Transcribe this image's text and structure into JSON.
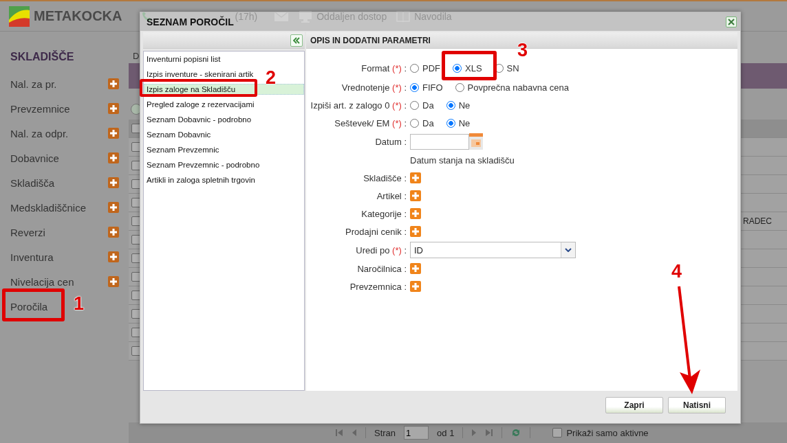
{
  "header": {
    "logo": "METAKOCKA",
    "links": [
      {
        "kind": "phone",
        "label": "(17h)"
      },
      {
        "kind": "mail"
      },
      {
        "kind": "remote",
        "label": "Oddaljen dostop"
      },
      {
        "kind": "manual",
        "label": "Navodila"
      }
    ]
  },
  "sidebar": {
    "title": "SKLADIŠČE",
    "items": [
      {
        "label": "Nal. za pr.",
        "add": true
      },
      {
        "label": "Prevzemnice",
        "add": true
      },
      {
        "label": "Nal. za odpr.",
        "add": true
      },
      {
        "label": "Dobavnice",
        "add": true
      },
      {
        "label": "Skladišča",
        "add": true
      },
      {
        "label": "Medskladiščnice",
        "add": true
      },
      {
        "label": "Reverzi",
        "add": true
      },
      {
        "label": "Inventura",
        "add": true
      },
      {
        "label": "Nivelacija cen",
        "add": true
      },
      {
        "label": "Poročila",
        "add": false
      }
    ]
  },
  "main": {
    "heading": "D",
    "table": {
      "header_checked": false,
      "rows": [
        {
          "checked": false
        },
        {
          "checked": false
        },
        {
          "checked": false
        },
        {
          "checked": false
        },
        {
          "checked": false,
          "column_3": "RADEC"
        },
        {
          "checked": false
        },
        {
          "checked": false
        },
        {
          "checked": false
        },
        {
          "checked": false
        },
        {
          "checked": false
        },
        {
          "checked": false
        },
        {
          "checked": false
        }
      ]
    },
    "pager": {
      "page_label": "Stran",
      "page": "1",
      "of": "od 1",
      "filter": {
        "label": "Prikaži samo aktivne",
        "checked": false
      }
    }
  },
  "dialog": {
    "title": "SEZNAM POROČIL",
    "reports": [
      {
        "label": "Inventurni popisni list",
        "selected": false
      },
      {
        "label": "Izpis inventure - skenirani artik",
        "selected": false
      },
      {
        "label": "Izpis zaloge na Skladišču",
        "selected": true
      },
      {
        "label": "Pregled zaloge z rezervacijami",
        "selected": false
      },
      {
        "label": "Seznam Dobavnic - podrobno",
        "selected": false
      },
      {
        "label": "Seznam Dobavnic",
        "selected": false
      },
      {
        "label": "Seznam Prevzemnic",
        "selected": false
      },
      {
        "label": "Seznam Prevzemnic - podrobno",
        "selected": false
      },
      {
        "label": "Artikli in zaloga spletnih trgovin",
        "selected": false
      }
    ],
    "params_title": "OPIS IN DODATNI PARAMETRI",
    "fields": [
      {
        "kind": "radio",
        "label": "Format",
        "mark": "(*)",
        "colon": ":",
        "options": [
          {
            "label": "PDF",
            "selected": false
          },
          {
            "label": "XLS",
            "selected": true
          },
          {
            "label": "SN",
            "selected": false
          }
        ]
      },
      {
        "kind": "radio",
        "label": "Vrednotenje",
        "mark": "(*)",
        "colon": ":",
        "options": [
          {
            "label": "FIFO",
            "selected": true
          },
          {
            "label": "Povprečna nabavna cena",
            "selected": false
          }
        ]
      },
      {
        "kind": "radio",
        "label": "Izpiši art. z zalogo 0",
        "mark": "(*)",
        "colon": ":",
        "options": [
          {
            "label": "Da",
            "selected": false
          },
          {
            "label": "Ne",
            "selected": true
          }
        ]
      },
      {
        "kind": "radio",
        "label": "Seštevek/ EM",
        "mark": "(*)",
        "colon": ":",
        "options": [
          {
            "label": "Da",
            "selected": false
          },
          {
            "label": "Ne",
            "selected": true
          }
        ]
      },
      {
        "kind": "date",
        "label": "Datum",
        "colon": ":",
        "hint": "Datum stanja na skladišču"
      },
      {
        "kind": "add",
        "label": "Skladišče",
        "colon": ":"
      },
      {
        "kind": "add",
        "label": "Artikel",
        "colon": ":"
      },
      {
        "kind": "add",
        "label": "Kategorije",
        "colon": ":"
      },
      {
        "kind": "add",
        "label": "Prodajni cenik",
        "colon": ":"
      },
      {
        "kind": "select",
        "label": "Uredi po",
        "mark": "(*)",
        "colon": ":",
        "value": "ID"
      },
      {
        "kind": "add",
        "label": "Naročilnica",
        "colon": ":"
      },
      {
        "kind": "add",
        "label": "Prevzemnica",
        "colon": ":"
      }
    ],
    "buttons": [
      {
        "label": "Zapri"
      },
      {
        "label": "Natisni"
      }
    ]
  },
  "annotations": [
    {
      "kind": "box",
      "label": "1"
    },
    {
      "kind": "box",
      "label": "2"
    },
    {
      "kind": "box",
      "label": "3"
    },
    {
      "kind": "arrow",
      "label": "4"
    }
  ]
}
